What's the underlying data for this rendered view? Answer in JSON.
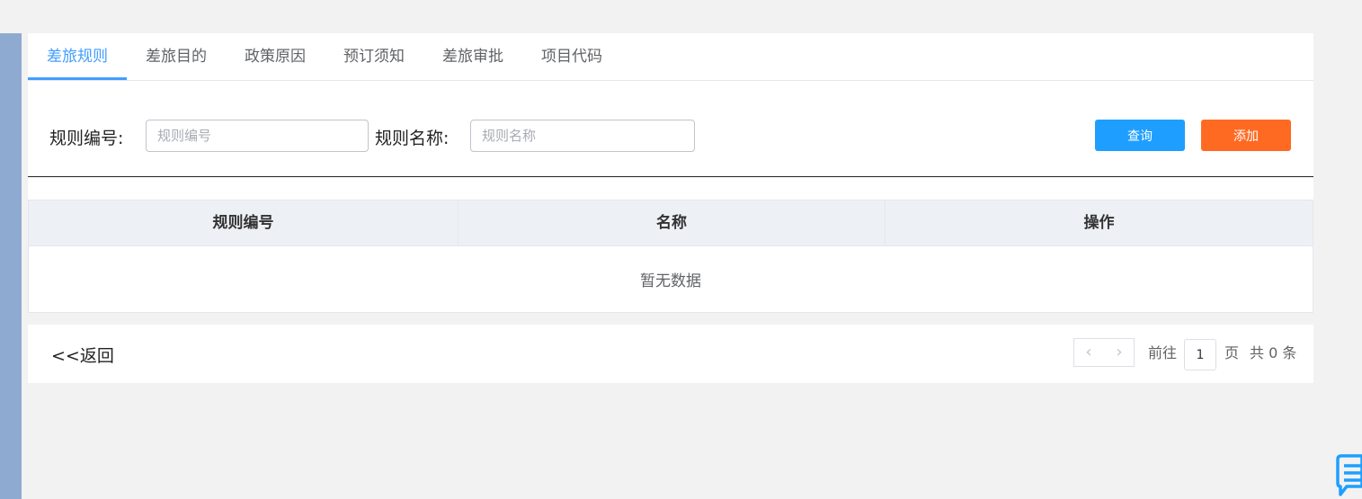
{
  "tabs": [
    {
      "label": "差旅规则",
      "active": true
    },
    {
      "label": "差旅目的",
      "active": false
    },
    {
      "label": "政策原因",
      "active": false
    },
    {
      "label": "预订须知",
      "active": false
    },
    {
      "label": "差旅审批",
      "active": false
    },
    {
      "label": "项目代码",
      "active": false
    }
  ],
  "search": {
    "rule_code_label": "规则编号:",
    "rule_code_placeholder": "规则编号",
    "rule_name_label": "规则名称:",
    "rule_name_placeholder": "规则名称",
    "query_button": "查询",
    "add_button": "添加"
  },
  "table": {
    "headers": [
      "规则编号",
      "名称",
      "操作"
    ],
    "rows": [],
    "empty_text": "暂无数据"
  },
  "footer": {
    "back_label": "<<返回",
    "prev_icon": "‹",
    "next_icon": "›",
    "goto_label": "前往",
    "current_page": "1",
    "page_unit": "页",
    "total_text": "共 0 条"
  },
  "colors": {
    "accent": "#409eff",
    "query_button": "#1e9fff",
    "add_button": "#ff6a23",
    "sidebar_strip": "#8eaad0",
    "chat_icon": "#1e9fff"
  },
  "icons": {
    "floating": "chat-icon"
  }
}
